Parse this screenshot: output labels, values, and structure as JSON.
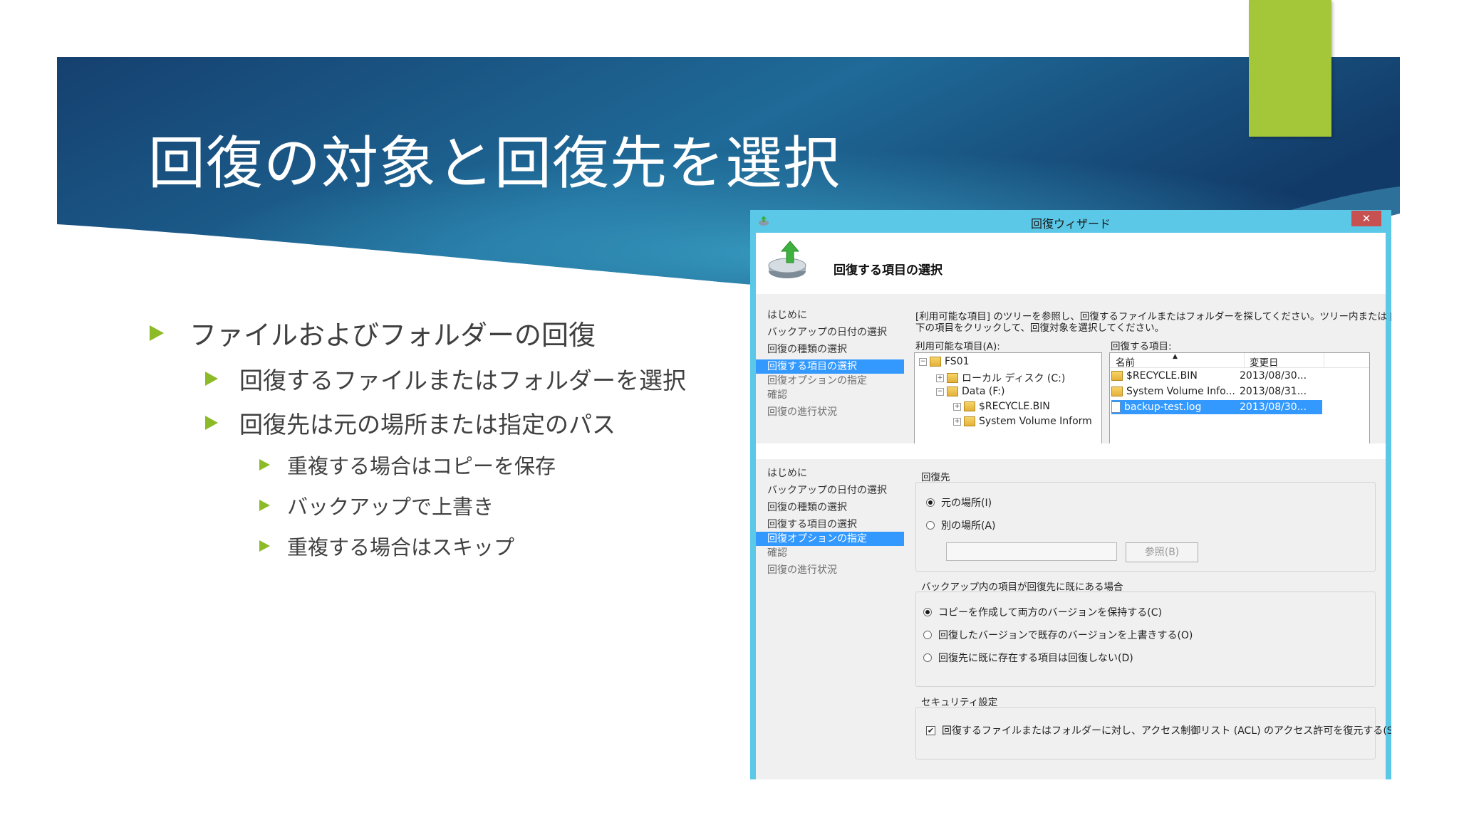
{
  "slide": {
    "title": "回復の対象と回復先を選択",
    "bullets": {
      "l1": "ファイルおよびフォルダーの回復",
      "l2a": "回復するファイルまたはフォルダーを選択",
      "l2b": "回復先は元の場所または指定のパス",
      "l3a": "重複する場合はコピーを保存",
      "l3b": "バックアップで上書き",
      "l3c": "重複する場合はスキップ"
    },
    "colors": {
      "banner_dark": "#123a68",
      "banner_light": "#2f8fb5",
      "accent": "#a4c639",
      "bullet": "#8dbb28"
    }
  },
  "dialog": {
    "title": "回復ウィザード",
    "close_label": "✕",
    "header_title": "回復する項目の選択",
    "nav": [
      "はじめに",
      "バックアップの日付の選択",
      "回復の種類の選択",
      "回復する項目の選択",
      "回復オプションの指定",
      "確認",
      "回復の進行状況"
    ],
    "items_step": {
      "description_line1": "[利用可能な項目] のツリーを参照し、回復するファイルまたはフォルダーを探してください。ツリー内または [名前] の",
      "description_line2": "下の項目をクリックして、回復対象を選択してください。",
      "available_label": "利用可能な項目(A):",
      "selected_label": "回復する項目:",
      "tree": [
        "FS01",
        "ローカル ディスク (C:)",
        "Data (F:)",
        "$RECYCLE.BIN",
        "System Volume Inform"
      ],
      "columns": [
        "名前",
        "変更日"
      ],
      "sort_arrow": "▲",
      "rows": [
        {
          "name": "$RECYCLE.BIN",
          "date": "2013/08/30..."
        },
        {
          "name": "System Volume Info...",
          "date": "2013/08/31..."
        },
        {
          "name": "backup-test.log",
          "date": "2013/08/30..."
        }
      ]
    },
    "options_step": {
      "dest_group": "回復先",
      "dest_original": "元の場所(I)",
      "dest_other": "別の場所(A)",
      "browse_label": "参照(B)",
      "conflict_group": "バックアップ内の項目が回復先に既にある場合",
      "conflict_copy": "コピーを作成して両方のバージョンを保持する(C)",
      "conflict_overwrite": "回復したバージョンで既存のバージョンを上書きする(O)",
      "conflict_skip": "回復先に既に存在する項目は回復しない(D)",
      "security_group": "セキュリティ設定",
      "security_acl": "回復するファイルまたはフォルダーに対し、アクセス制御リスト (ACL) のアクセス許可を復元する(S)",
      "security_checked": true
    }
  }
}
